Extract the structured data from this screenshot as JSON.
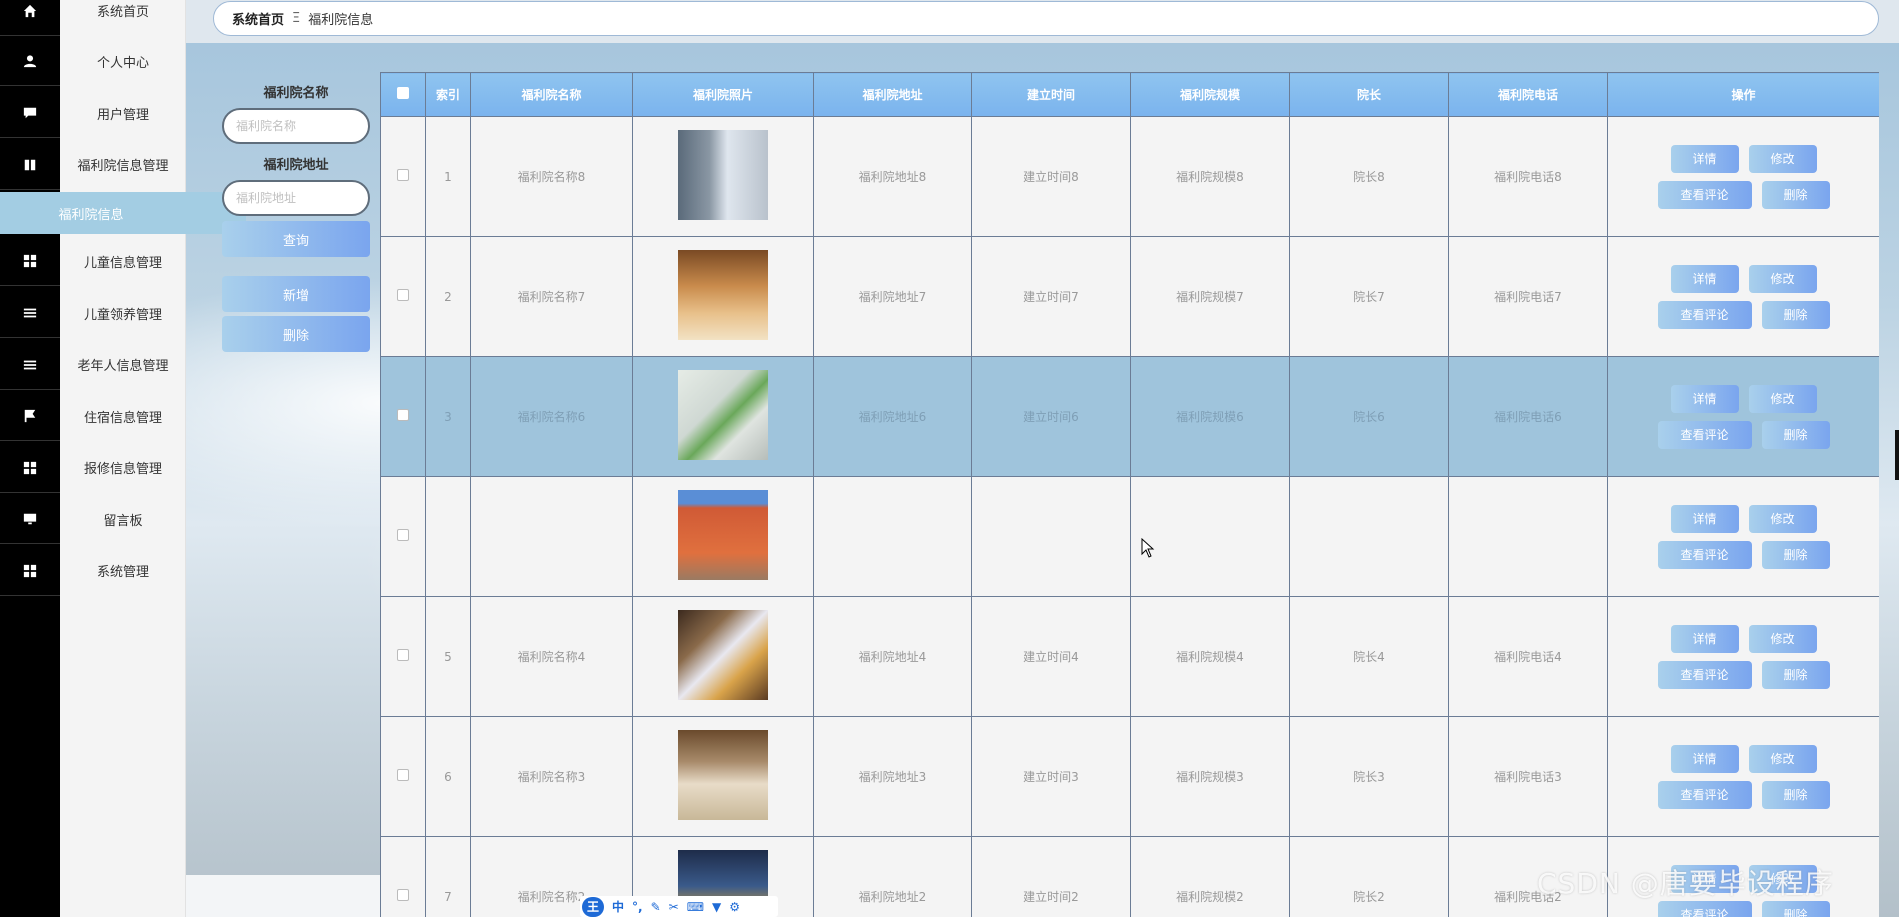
{
  "sidebar": {
    "items": [
      {
        "label": "系统首页",
        "icon": "home-icon"
      },
      {
        "label": "个人中心",
        "icon": "user-icon"
      },
      {
        "label": "用户管理",
        "icon": "chat-icon"
      },
      {
        "label": "福利院信息管理",
        "icon": "book-icon"
      },
      {
        "label": "儿童信息管理",
        "icon": "grid-icon"
      },
      {
        "label": "儿童领养管理",
        "icon": "list-icon"
      },
      {
        "label": "老年人信息管理",
        "icon": "list-icon"
      },
      {
        "label": "住宿信息管理",
        "icon": "flag-icon"
      },
      {
        "label": "报修信息管理",
        "icon": "grid-icon"
      },
      {
        "label": "留言板",
        "icon": "monitor-icon"
      },
      {
        "label": "系统管理",
        "icon": "grid-icon"
      }
    ],
    "active_label": "福利院信息"
  },
  "breadcrumb": {
    "home": "系统首页",
    "separator": "Ξ",
    "current": "福利院信息"
  },
  "search": {
    "name_label": "福利院名称",
    "name_placeholder": "福利院名称",
    "addr_label": "福利院地址",
    "addr_placeholder": "福利院地址",
    "query_button": "查询",
    "add_button": "新增",
    "delete_button": "删除"
  },
  "table": {
    "headers": [
      "索引",
      "福利院名称",
      "福利院照片",
      "福利院地址",
      "建立时间",
      "福利院规模",
      "院长",
      "福利院电话",
      "操作"
    ],
    "rows": [
      {
        "index": "1",
        "name": "福利院名称8",
        "photo": "building-exterior",
        "addr": "福利院地址8",
        "time": "建立时间8",
        "scale": "福利院规模8",
        "head": "院长8",
        "phone": "福利院电话8"
      },
      {
        "index": "2",
        "name": "福利院名称7",
        "photo": "dining-room",
        "addr": "福利院地址7",
        "time": "建立时间7",
        "scale": "福利院规模7",
        "head": "院长7",
        "phone": "福利院电话7"
      },
      {
        "index": "3",
        "name": "福利院名称6",
        "photo": "clinic-interior",
        "addr": "福利院地址6",
        "time": "建立时间6",
        "scale": "福利院规模6",
        "head": "院长6",
        "phone": "福利院电话6"
      },
      {
        "index": "",
        "name": "",
        "photo": "red-building",
        "addr": "",
        "time": "",
        "scale": "",
        "head": "",
        "phone": ""
      },
      {
        "index": "5",
        "name": "福利院名称4",
        "photo": "lobby-chandelier",
        "addr": "福利院地址4",
        "time": "建立时间4",
        "scale": "福利院规模4",
        "head": "院长4",
        "phone": "福利院电话4"
      },
      {
        "index": "6",
        "name": "福利院名称3",
        "photo": "hallway",
        "addr": "福利院地址3",
        "time": "建立时间3",
        "scale": "福利院规模3",
        "head": "院长3",
        "phone": "福利院电话3"
      },
      {
        "index": "7",
        "name": "福利院名称2",
        "photo": "night-lobby",
        "addr": "福利院地址2",
        "time": "建立时间2",
        "scale": "福利院规模2",
        "head": "院长2",
        "phone": "福利院电话2"
      }
    ],
    "ops": {
      "detail": "详情",
      "edit": "修改",
      "comments": "查看评论",
      "delete": "删除"
    }
  },
  "ime": {
    "badge": "王",
    "mode": "中"
  },
  "watermark": "CSDN @唐要毕设程序"
}
